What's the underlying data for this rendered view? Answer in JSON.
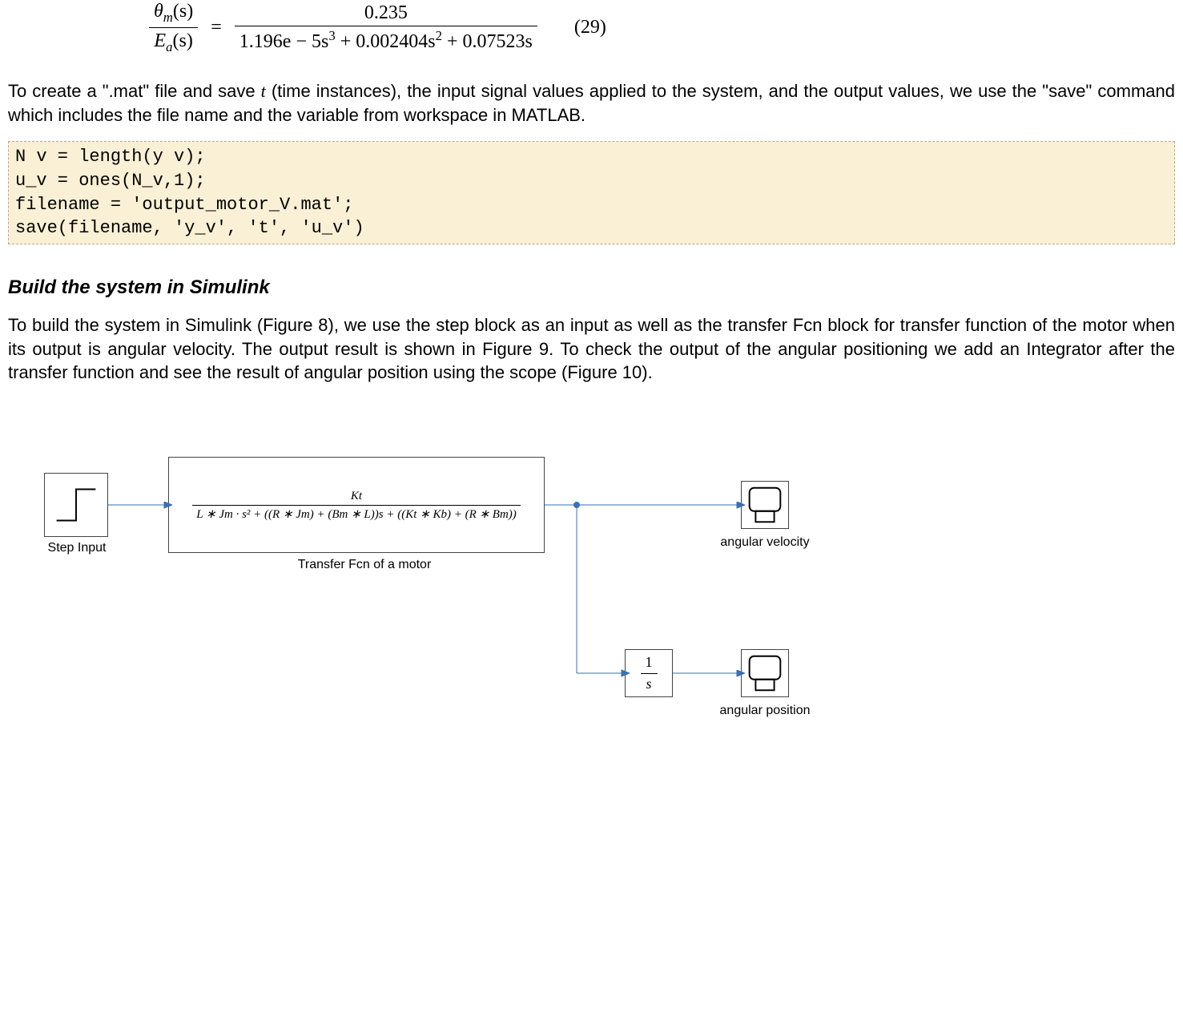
{
  "equation": {
    "lhs_num_var": "θ",
    "lhs_num_sub": "m",
    "lhs_num_arg": "(s)",
    "lhs_den_var": "E",
    "lhs_den_sub": "a",
    "lhs_den_arg": "(s)",
    "rhs_num": "0.235",
    "rhs_den_pre": "1.196e − 5s",
    "rhs_den_exp1": "3",
    "rhs_den_mid": " + 0.002404s",
    "rhs_den_exp2": "2",
    "rhs_den_tail": " + 0.07523s",
    "number": "(29)"
  },
  "para1_a": "To create a \".mat\" file and save ",
  "para1_var": "t",
  "para1_b": " (time instances), the input signal values applied to the system, and the output values, we use the \"save\" command which includes the file name and the variable from workspace in MATLAB.",
  "code": {
    "l1": "N v = length(y v);",
    "l2": "u_v = ones(N_v,1);",
    "l3": "filename = 'output_motor_V.mat';",
    "l4": "save(filename, 'y_v', 't', 'u_v')"
  },
  "subheading": "Build the system in Simulink",
  "para2": "To build the system in Simulink (Figure 8), we use the step block as an input as well as the transfer Fcn block for transfer function of the motor when its output is angular velocity. The output result is shown in Figure 9. To check the output of the angular positioning we add an Integrator after the transfer function and see the result of angular position using the scope (Figure 10).",
  "diagram": {
    "step_label": "Step Input",
    "tf_num": "Kt",
    "tf_den": "L ∗ Jm · s² + ((R ∗ Jm) + (Bm ∗ L))s + ((Kt ∗ Kb) + (R ∗ Bm))",
    "tf_label": "Transfer Fcn of a motor",
    "scope1_label": "angular velocity",
    "scope2_label": "angular position",
    "integrator_num": "1",
    "integrator_den": "s"
  }
}
